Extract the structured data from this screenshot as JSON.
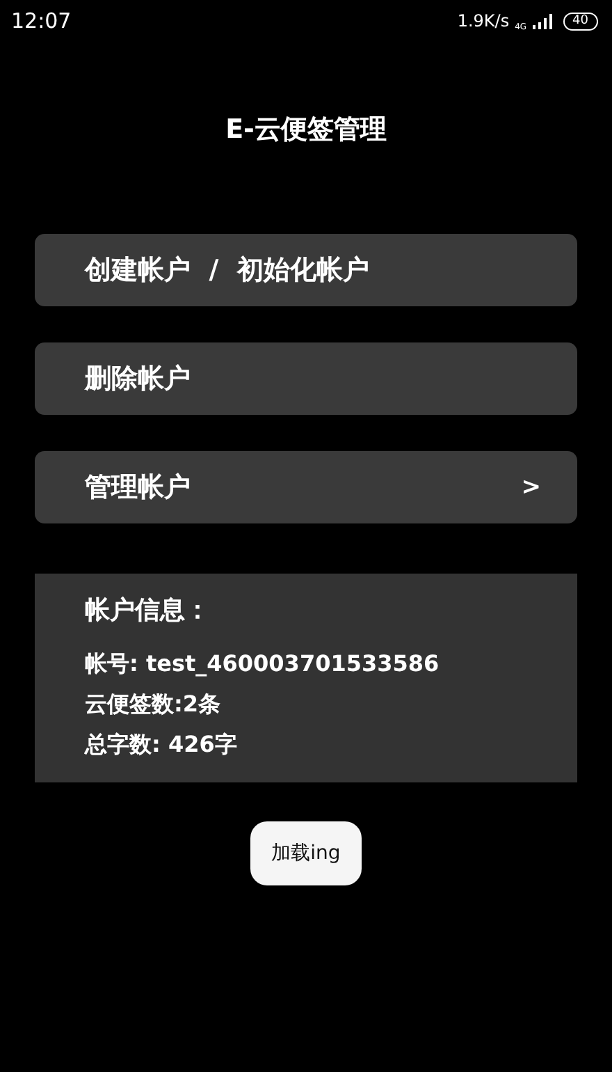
{
  "status_bar": {
    "time": "12:07",
    "speed": "1.9K/s",
    "network": "4G",
    "battery": "40"
  },
  "title": "E-云便签管理",
  "menu": [
    {
      "label": "创建帐户  /  初始化帐户"
    },
    {
      "label": "删除帐户"
    },
    {
      "label": "管理帐户",
      "arrow": ">"
    }
  ],
  "info": {
    "heading": "帐户信息：",
    "lines": [
      "帐号: test_460003701533586",
      "云便签数:2条",
      "总字数: 426字"
    ]
  },
  "button": "加载ing"
}
